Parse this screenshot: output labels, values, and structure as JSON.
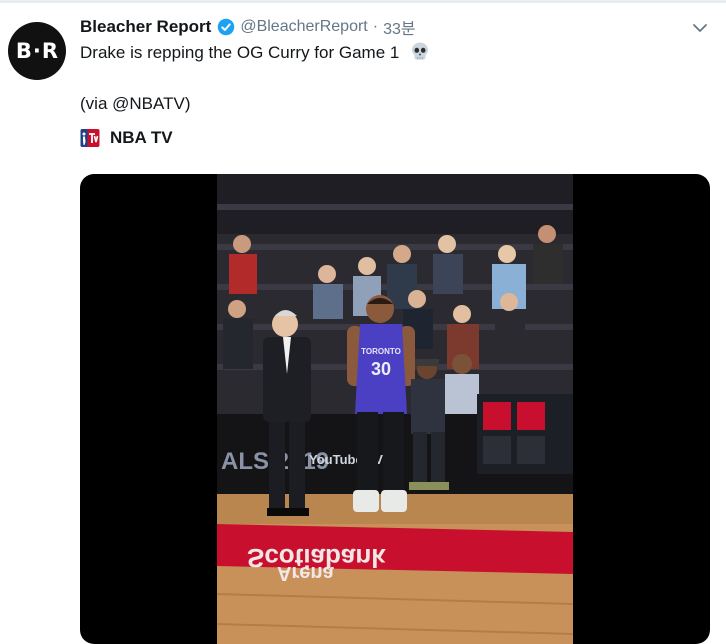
{
  "tweet": {
    "avatar_text": "B",
    "avatar_text2": "R",
    "display_name": "Bleacher Report",
    "handle": "@BleacherReport",
    "separator": "·",
    "time": "33분",
    "text": "Drake is repping the OG Curry for Game 1",
    "via_prefix": "(via ",
    "via_handle": "@NBATV",
    "via_suffix": ")",
    "source_label": "NBA TV"
  },
  "video": {
    "jersey_team": "TORONTO",
    "jersey_number": "30",
    "court_text_1": "Scotiabank",
    "court_text_2": "Arena",
    "board_text": "ALS 2019",
    "board_text_2": "YouTube TV"
  },
  "colors": {
    "verified": "#1da1f2",
    "jersey": "#4b3fc4",
    "court_red": "#c8102e",
    "floor": "#c9915a"
  }
}
